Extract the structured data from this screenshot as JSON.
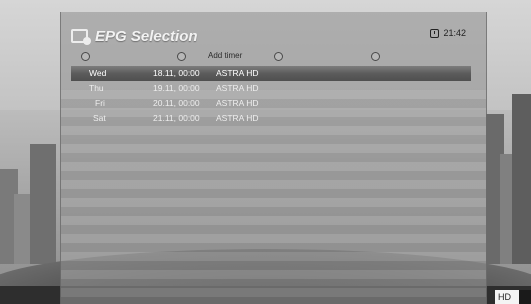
{
  "screen": {
    "title": "EPG Selection",
    "clock": "21:42",
    "hd_badge": "HD"
  },
  "function_keys": [
    {
      "color": "#d84a3a",
      "label": ""
    },
    {
      "color": "#3aa24a",
      "label": "Add timer"
    },
    {
      "color": "#e0c03a",
      "label": ""
    },
    {
      "color": "#3a6ad8",
      "label": ""
    }
  ],
  "entries": [
    {
      "day": "Wed",
      "datetime": "18.11, 00:00",
      "channel": "ASTRA HD",
      "selected": true
    },
    {
      "day": "Thu",
      "datetime": "19.11, 00:00",
      "channel": "ASTRA HD",
      "selected": false
    },
    {
      "day": "Fri",
      "datetime": "20.11, 00:00",
      "channel": "ASTRA HD",
      "selected": false
    },
    {
      "day": "Sat",
      "datetime": "21.11, 00:00",
      "channel": "ASTRA HD",
      "selected": false
    }
  ]
}
